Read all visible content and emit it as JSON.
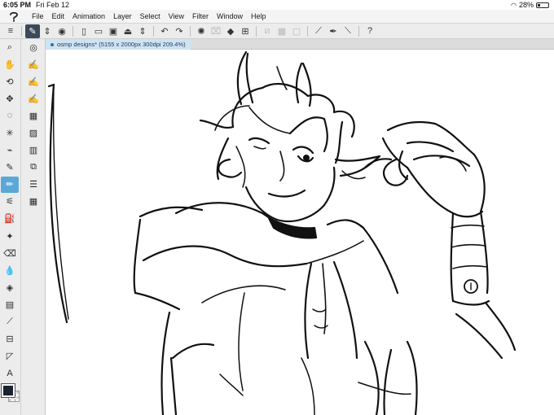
{
  "status_bar": {
    "time": "6:05 PM",
    "date": "Fri Feb 12",
    "battery": "28%",
    "battery_level": 0.28
  },
  "menu": {
    "items": [
      "File",
      "Edit",
      "Animation",
      "Layer",
      "Select",
      "View",
      "Filter",
      "Window",
      "Help"
    ]
  },
  "toolbar": {
    "buttons": [
      {
        "name": "menu-icon",
        "glyph": "≡"
      },
      {
        "name": "edit-layer-icon",
        "glyph": "✎",
        "active": true
      },
      {
        "name": "stepper-icon",
        "glyph": "⇕"
      },
      {
        "name": "eye-icon",
        "glyph": "◉"
      },
      {
        "name": "new-page-icon",
        "glyph": "▯"
      },
      {
        "name": "open-folder-icon",
        "glyph": "▭"
      },
      {
        "name": "save-icon",
        "glyph": "▣"
      },
      {
        "name": "print-icon",
        "glyph": "⏏"
      },
      {
        "name": "stepper-icon-2",
        "glyph": "⇕"
      },
      {
        "name": "undo-icon",
        "glyph": "↶"
      },
      {
        "name": "redo-icon",
        "glyph": "↷"
      },
      {
        "name": "loading-icon",
        "glyph": "✺"
      },
      {
        "name": "clear-selection-icon",
        "glyph": "⌧",
        "disabled": true
      },
      {
        "name": "fill-icon",
        "glyph": "◆"
      },
      {
        "name": "crop-icon",
        "glyph": "⊞"
      },
      {
        "name": "deselect-icon",
        "glyph": "⧄",
        "disabled": true
      },
      {
        "name": "invert-selection-icon",
        "glyph": "▩",
        "disabled": true
      },
      {
        "name": "selection-border-icon",
        "glyph": "▢",
        "disabled": true
      },
      {
        "name": "ruler-icon",
        "glyph": "⟋"
      },
      {
        "name": "pen-stroke-icon",
        "glyph": "✒"
      },
      {
        "name": "straight-line-icon",
        "glyph": "⟍"
      },
      {
        "name": "help-icon",
        "glyph": "?"
      }
    ]
  },
  "tools_a": [
    {
      "name": "zoom-icon",
      "glyph": "⌕"
    },
    {
      "name": "hand-icon",
      "glyph": "✋"
    },
    {
      "name": "rotate-view-icon",
      "glyph": "⟲"
    },
    {
      "name": "move-icon",
      "glyph": "✥"
    },
    {
      "name": "lasso-icon",
      "glyph": "◌"
    },
    {
      "name": "magic-wand-icon",
      "glyph": "✳"
    },
    {
      "name": "eyedropper-icon",
      "glyph": "⌁"
    },
    {
      "name": "pen-icon",
      "glyph": "✎"
    },
    {
      "name": "pencil-icon",
      "glyph": "✏",
      "active": true
    },
    {
      "name": "brush-icon",
      "glyph": "⚟"
    },
    {
      "name": "airbrush-icon",
      "glyph": "⛽"
    },
    {
      "name": "decoration-icon",
      "glyph": "✦"
    },
    {
      "name": "eraser-icon",
      "glyph": "⌫"
    },
    {
      "name": "blend-icon",
      "glyph": "💧"
    },
    {
      "name": "fill-bucket-icon",
      "glyph": "◈"
    },
    {
      "name": "gradient-icon",
      "glyph": "▤"
    },
    {
      "name": "line-icon",
      "glyph": "⟋"
    },
    {
      "name": "frame-icon",
      "glyph": "⊟"
    },
    {
      "name": "balloon-icon",
      "glyph": "◸"
    },
    {
      "name": "text-icon",
      "glyph": "A"
    },
    {
      "name": "correct-line-icon",
      "glyph": "⋗"
    }
  ],
  "tools_b": [
    {
      "name": "navigator-icon",
      "glyph": "◎"
    },
    {
      "name": "sub-tool-pencil-icon",
      "glyph": "✍"
    },
    {
      "name": "sub-tool-brush-icon",
      "glyph": "✍"
    },
    {
      "name": "sub-tool-paint-icon",
      "glyph": "✍"
    },
    {
      "name": "tool-property-icon",
      "glyph": "▦"
    },
    {
      "name": "brush-size-icon",
      "glyph": "▨"
    },
    {
      "name": "color-set-icon",
      "glyph": "▥"
    },
    {
      "name": "layer-property-icon",
      "glyph": "⧉"
    },
    {
      "name": "layers-icon",
      "glyph": "☰"
    },
    {
      "name": "material-icon",
      "glyph": "▦"
    }
  ],
  "canvas_tab": {
    "title": "osmp designs* (5155 x 2000px 300dpi 209.4%)"
  }
}
